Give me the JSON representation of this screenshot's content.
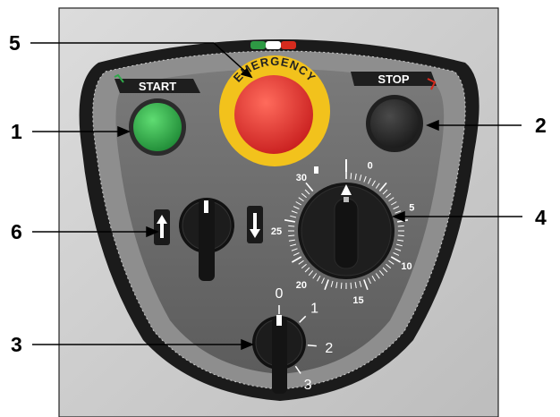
{
  "panel": {
    "start_label": "START",
    "stop_label": "STOP",
    "emergency_label": "EMERGENCY",
    "flag_colors": [
      "#2e9a44",
      "#ffffff",
      "#d52b1e"
    ],
    "start_button_color": "#2fa84a",
    "stop_button_color": "#2c2c2c",
    "emergency_button_color": "#e22a2a",
    "emergency_ring_color": "#f2c21c"
  },
  "callouts": [
    {
      "number": "1",
      "target": "start-button"
    },
    {
      "number": "2",
      "target": "stop-button"
    },
    {
      "number": "3",
      "target": "speed-selector-knob"
    },
    {
      "number": "4",
      "target": "timer-dial-knob"
    },
    {
      "number": "5",
      "target": "emergency-stop-button"
    },
    {
      "number": "6",
      "target": "direction-selector-knob"
    }
  ],
  "timer_dial": {
    "labels": [
      "0",
      "5",
      "10",
      "15",
      "20",
      "25",
      "30"
    ]
  },
  "speed_selector": {
    "positions": [
      "0",
      "1",
      "2",
      "3"
    ]
  },
  "direction_selector": {
    "left_icon": "arrow-up-icon",
    "right_icon": "arrow-down-icon"
  }
}
